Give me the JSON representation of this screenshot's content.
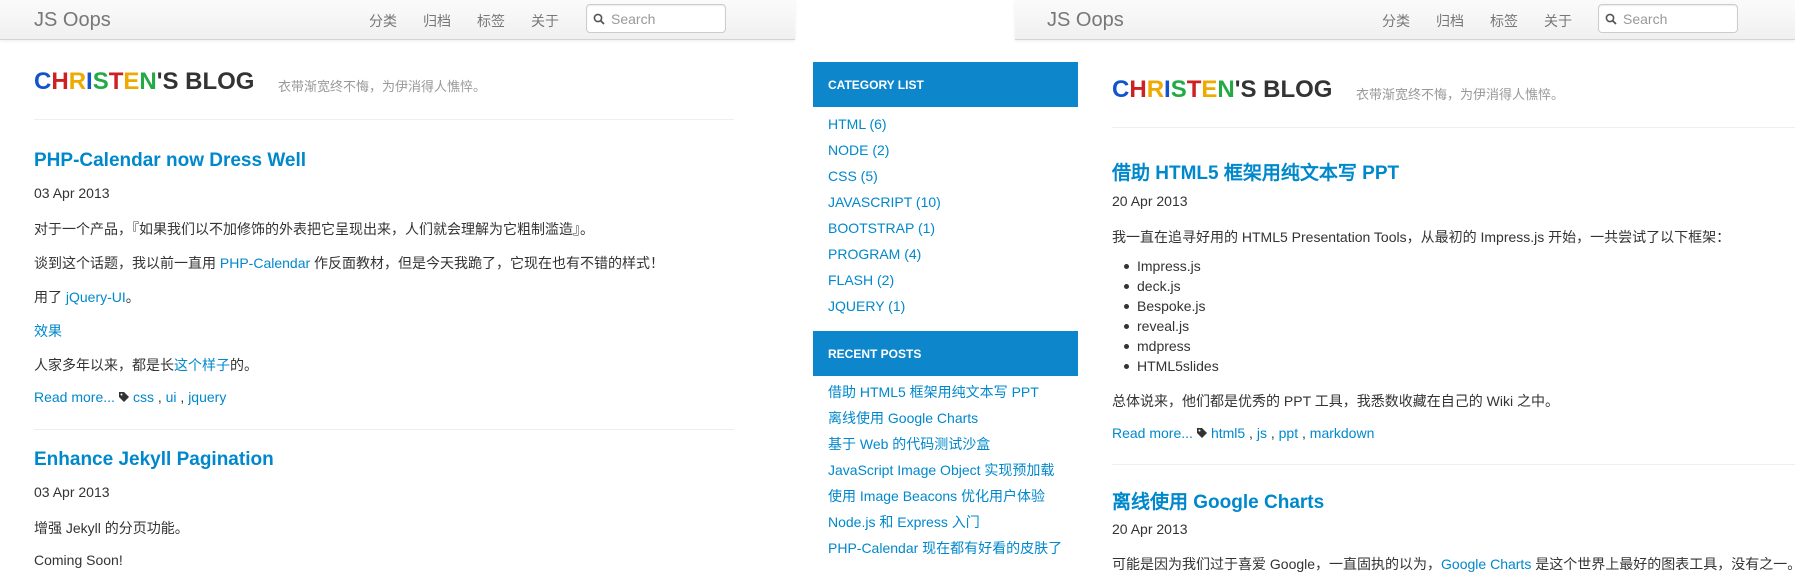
{
  "left_nav": {
    "brand": "JS Oops",
    "menu": [
      "分类",
      "归档",
      "标签",
      "关于"
    ],
    "search_placeholder": "Search"
  },
  "right_nav": {
    "brand": "JS Oops",
    "menu": [
      "分类",
      "归档",
      "标签",
      "关于"
    ],
    "search_placeholder": "Search"
  },
  "logo": {
    "letters": [
      "C",
      "H",
      "R",
      "I",
      "S",
      "T",
      "E",
      "N"
    ],
    "letter_colors": [
      "#1155cc",
      "#cc2222",
      "#eeaa00",
      "#1155cc",
      "#22aa44",
      "#cc2222",
      "#eeaa00",
      "#22aa44"
    ],
    "rest": "'S BLOG",
    "tagline": "衣带渐宽终不悔，为伊消得人憔悴。"
  },
  "left_posts": [
    {
      "title": "PHP-Calendar now Dress Well",
      "date": "03 Apr 2013",
      "p1": "对于一个产品，『如果我们以不加修饰的外表把它呈现出来，人们就会理解为它粗制滥造』。",
      "p2_before": "谈到这个话题，我以前一直用 ",
      "p2_link": "PHP-Calendar",
      "p2_after": " 作反面教材，但是今天我跪了，它现在也有不错的样式！",
      "p3_before": "用了 ",
      "p3_link": "jQuery-UI",
      "p3_after": "。",
      "p4_link": "效果",
      "p5_before": "人家多年以来，都是长",
      "p5_link": "这个样子",
      "p5_after": "的。",
      "read_more": "Read more...",
      "tags": [
        "css",
        "ui",
        "jquery"
      ]
    },
    {
      "title": "Enhance Jekyll Pagination",
      "date": "03 Apr 2013",
      "p1": "增强 Jekyll 的分页功能。",
      "p2": "Coming Soon!"
    }
  ],
  "sidebar": {
    "category_title": "CATEGORY LIST",
    "categories": [
      "HTML (6)",
      "NODE (2)",
      "CSS (5)",
      "JAVASCRIPT (10)",
      "BOOTSTRAP (1)",
      "PROGRAM (4)",
      "FLASH (2)",
      "JQUERY (1)"
    ],
    "recent_title": "RECENT POSTS",
    "recent": [
      "借助 HTML5 框架用纯文本写 PPT",
      "离线使用 Google Charts",
      "基于 Web 的代码测试沙盒",
      "JavaScript Image Object 实现预加载",
      "使用 Image Beacons 优化用户体验",
      "Node.js 和 Express 入门",
      "PHP-Calendar 现在都有好看的皮肤了"
    ]
  },
  "right_posts": [
    {
      "title": "借助 HTML5 框架用纯文本写 PPT",
      "date": "20 Apr 2013",
      "intro": "我一直在追寻好用的 HTML5 Presentation Tools，从最初的 Impress.js 开始，一共尝试了以下框架：",
      "list": [
        "Impress.js",
        "deck.js",
        "Bespoke.js",
        "reveal.js",
        "mdpress",
        "HTML5slides"
      ],
      "summary": "总体说来，他们都是优秀的 PPT 工具，我悉数收藏在自己的 Wiki 之中。",
      "read_more": "Read more...",
      "tags": [
        "html5",
        "js",
        "ppt",
        "markdown"
      ]
    },
    {
      "title": "离线使用 Google Charts",
      "date": "20 Apr 2013",
      "p_before": "可能是因为我们过于喜爱 Google，一直固执的以为，",
      "p_link": "Google Charts",
      "p_after": " 是这个世界上最好的图表工具，没有之一。"
    }
  ]
}
